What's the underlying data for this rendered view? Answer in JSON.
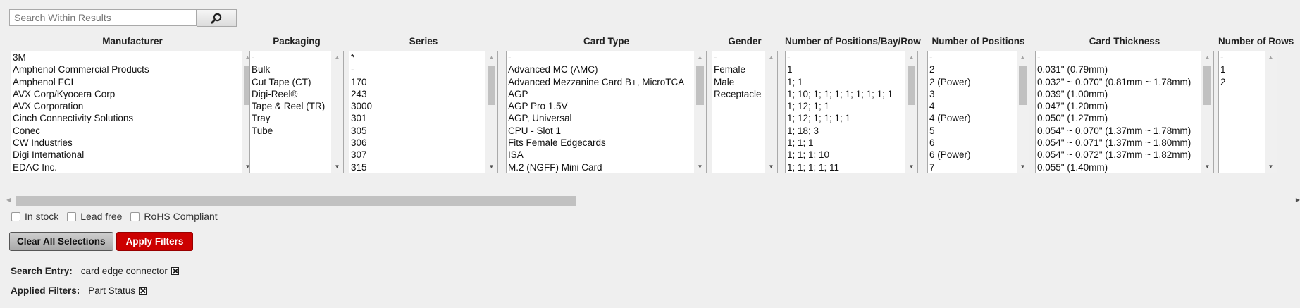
{
  "search": {
    "placeholder": "Search Within Results",
    "button_icon": "search-icon"
  },
  "filters": [
    {
      "id": "manufacturer",
      "title": "Manufacturer",
      "options": [
        "3M",
        "Amphenol Commercial Products",
        "Amphenol FCI",
        "AVX Corp/Kyocera Corp",
        "AVX Corporation",
        "Cinch Connectivity Solutions",
        "Conec",
        "CW Industries",
        "Digi International",
        "EDAC Inc."
      ],
      "scroll": {
        "thumb_visible": true
      }
    },
    {
      "id": "packaging",
      "title": "Packaging",
      "options": [
        "-",
        "Bulk",
        "Cut Tape (CT)",
        "Digi-Reel®",
        "Tape & Reel (TR)",
        "Tray",
        "Tube"
      ],
      "scroll": {
        "thumb_visible": false
      }
    },
    {
      "id": "series",
      "title": "Series",
      "options": [
        "*",
        "-",
        "170",
        "243",
        "3000",
        "301",
        "305",
        "306",
        "307",
        "315"
      ],
      "scroll": {
        "thumb_visible": true
      }
    },
    {
      "id": "card-type",
      "title": "Card Type",
      "options": [
        "-",
        "Advanced MC (AMC)",
        "Advanced Mezzanine Card B+, MicroTCA",
        "AGP",
        "AGP Pro 1.5V",
        "AGP, Universal",
        "CPU - Slot 1",
        "Fits Female Edgecards",
        "ISA",
        "M.2 (NGFF) Mini Card"
      ],
      "scroll": {
        "thumb_visible": true
      }
    },
    {
      "id": "gender",
      "title": "Gender",
      "options": [
        "-",
        "Female",
        "Male",
        "Receptacle"
      ],
      "scroll": {
        "thumb_visible": false
      }
    },
    {
      "id": "positions-bay-row",
      "title": "Number of Positions/Bay/Row",
      "options": [
        "-",
        "1",
        "1; 1",
        "1; 10; 1; 1; 1; 1; 1; 1; 1; 1",
        "1; 12; 1; 1",
        "1; 12; 1; 1; 1; 1",
        "1; 18; 3",
        "1; 1; 1",
        "1; 1; 1; 10",
        "1; 1; 1; 1; 11"
      ],
      "scroll": {
        "thumb_visible": true
      }
    },
    {
      "id": "positions",
      "title": "Number of Positions",
      "options": [
        "-",
        "2",
        "2 (Power)",
        "3",
        "4",
        "4 (Power)",
        "5",
        "6",
        "6 (Power)",
        "7"
      ],
      "scroll": {
        "thumb_visible": true
      }
    },
    {
      "id": "card-thickness",
      "title": "Card Thickness",
      "options": [
        "-",
        "0.031\" (0.79mm)",
        "0.032\" ~ 0.070\" (0.81mm ~ 1.78mm)",
        "0.039\" (1.00mm)",
        "0.047\" (1.20mm)",
        "0.050\" (1.27mm)",
        "0.054\" ~ 0.070\" (1.37mm ~ 1.78mm)",
        "0.054\" ~ 0.071\" (1.37mm ~ 1.80mm)",
        "0.054\" ~ 0.072\" (1.37mm ~ 1.82mm)",
        "0.055\" (1.40mm)"
      ],
      "scroll": {
        "thumb_visible": true
      }
    },
    {
      "id": "rows",
      "title": "Number of Rows",
      "options": [
        "-",
        "1",
        "2"
      ],
      "scroll": {
        "thumb_visible": false
      }
    }
  ],
  "checkboxes": [
    {
      "label": "In stock",
      "checked": false
    },
    {
      "label": "Lead free",
      "checked": false
    },
    {
      "label": "RoHS Compliant",
      "checked": false
    }
  ],
  "buttons": {
    "clear": "Clear All Selections",
    "apply": "Apply Filters"
  },
  "search_entry": {
    "label": "Search Entry:",
    "value": "card edge connector"
  },
  "applied_filters": {
    "label": "Applied Filters:",
    "value": "Part Status"
  },
  "colors": {
    "apply_button": "#cc0000",
    "background": "#efefef"
  }
}
